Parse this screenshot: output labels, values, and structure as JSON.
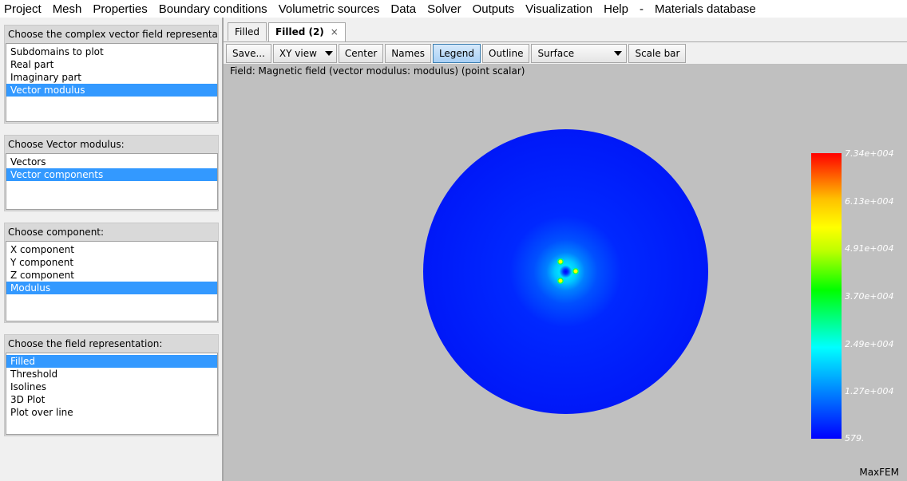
{
  "menu": [
    "Project",
    "Mesh",
    "Properties",
    "Boundary conditions",
    "Volumetric sources",
    "Data",
    "Solver",
    "Outputs",
    "Visualization",
    "Help",
    "-",
    "Materials database"
  ],
  "groups": [
    {
      "title": "Choose the complex vector field representation",
      "items": [
        "Subdomains to plot",
        "Real part",
        "Imaginary part",
        "Vector modulus"
      ],
      "selected": 3
    },
    {
      "title": "Choose Vector modulus:",
      "items": [
        "Vectors",
        "Vector components"
      ],
      "selected": 1
    },
    {
      "title": "Choose component:",
      "items": [
        "X component",
        "Y component",
        "Z component",
        "Modulus"
      ],
      "selected": 3
    },
    {
      "title": "Choose the field representation:",
      "items": [
        "Filled",
        "Threshold",
        "Isolines",
        "3D Plot",
        "Plot over line"
      ],
      "selected": 0
    }
  ],
  "tabs": [
    {
      "label": "Filled",
      "active": false
    },
    {
      "label": "Filled (2)",
      "active": true,
      "close": "×"
    }
  ],
  "toolbar": {
    "save": "Save...",
    "view": "XY view",
    "center": "Center",
    "names": "Names",
    "legend": "Legend",
    "outline": "Outline",
    "surface": "Surface",
    "scalebar": "Scale bar"
  },
  "view": {
    "field_label": "Field: Magnetic field (vector modulus: modulus) (point scalar)",
    "colorbar_ticks": [
      "7.34e+004",
      "6.13e+004",
      "4.91e+004",
      "3.70e+004",
      "2.49e+004",
      "1.27e+004",
      "579."
    ],
    "brand": "MaxFEM"
  },
  "colors": {
    "selection": "#3399ff",
    "pressed": "#a9d0f5",
    "background": "#c0c0c0"
  }
}
